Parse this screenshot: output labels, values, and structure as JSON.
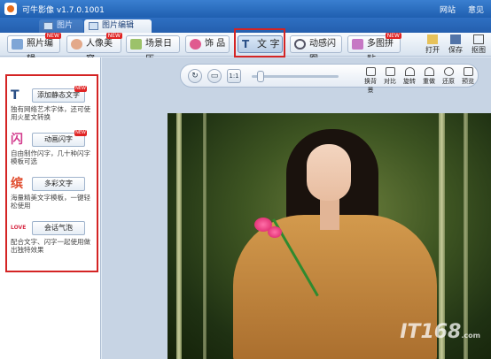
{
  "app": {
    "title": "可牛影像  v1.7.0.1001",
    "links": [
      "网站",
      "意见"
    ]
  },
  "top_tabs": [
    "图片库",
    "图片编辑"
  ],
  "toolbar": {
    "buttons": [
      "照片编辑",
      "人像美容",
      "场景日历",
      "饰 品",
      "文 字",
      "动感闪图",
      "多图拼贴"
    ],
    "new_badge": "NEW",
    "right_tools": [
      "打开",
      "保存",
      "抠图"
    ]
  },
  "left_panel": {
    "features": [
      {
        "icon": "T",
        "button": "添加静态文字",
        "desc": "独有网络艺术字体，还可使用火星文转换"
      },
      {
        "icon": "闪",
        "button": "动画闪字",
        "desc": "自由制作闪字，几十种闪字模板可选"
      },
      {
        "icon": "缤",
        "button": "多彩文字",
        "desc": "海量精美文字模板，一键轻松使用"
      },
      {
        "icon": "LOVE",
        "button": "会话气泡",
        "desc": "配合文字、闪字一起使用做出独特效果"
      }
    ]
  },
  "canvas": {
    "tools": [
      "换背景",
      "对比",
      "旋转",
      "重做",
      "还原",
      "预览"
    ],
    "round_icons": [
      "rotate-icon",
      "monitor-icon",
      "fit-icon"
    ],
    "watermark": "IT168",
    "watermark_sub": ".com"
  },
  "colors": {
    "title_bar": "#1f5fb0",
    "highlight": "#d42424",
    "badge": "#e02424"
  }
}
